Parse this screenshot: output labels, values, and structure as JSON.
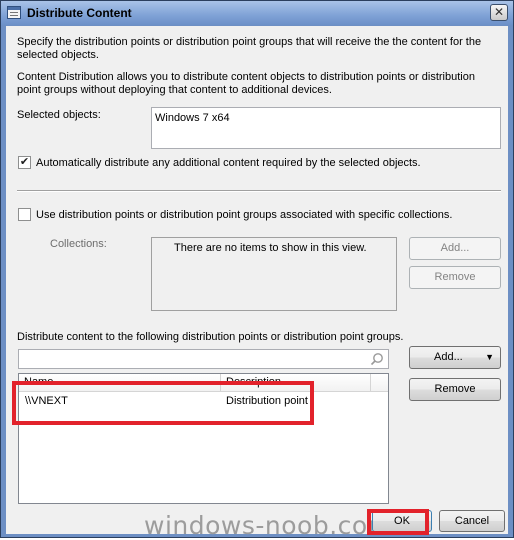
{
  "window": {
    "title": "Distribute Content",
    "close_glyph": "✕"
  },
  "intro": {
    "line1": "Specify the distribution points or distribution point groups that will receive the the content for the selected objects.",
    "line2": "Content Distribution allows you to distribute content objects to distribution points or distribution point groups without deploying that content to additional devices."
  },
  "selected_objects": {
    "label": "Selected objects:",
    "value": "Windows 7 x64"
  },
  "auto_distribute": {
    "checked": true,
    "label": "Automatically distribute any additional content required by the selected objects."
  },
  "collections_option": {
    "checked": false,
    "label": "Use distribution points or distribution point groups associated with specific collections."
  },
  "collections": {
    "label": "Collections:",
    "empty_text": "There are no items to show in this view.",
    "add_label": "Add...",
    "remove_label": "Remove"
  },
  "targets": {
    "label": "Distribute content to the following distribution points or distribution point groups.",
    "search_placeholder": "",
    "columns": [
      "Name",
      "Description"
    ],
    "rows": [
      {
        "name": "\\\\VNEXT",
        "description": "Distribution point"
      }
    ],
    "add_label": "Add...",
    "add_arrow": "▼",
    "remove_label": "Remove"
  },
  "footer": {
    "watermark": "windows-noob.com",
    "ok_label": "OK",
    "cancel_label": "Cancel"
  },
  "colors": {
    "highlight_box": "#e2222b",
    "title_bar": "#7fa2d6"
  }
}
